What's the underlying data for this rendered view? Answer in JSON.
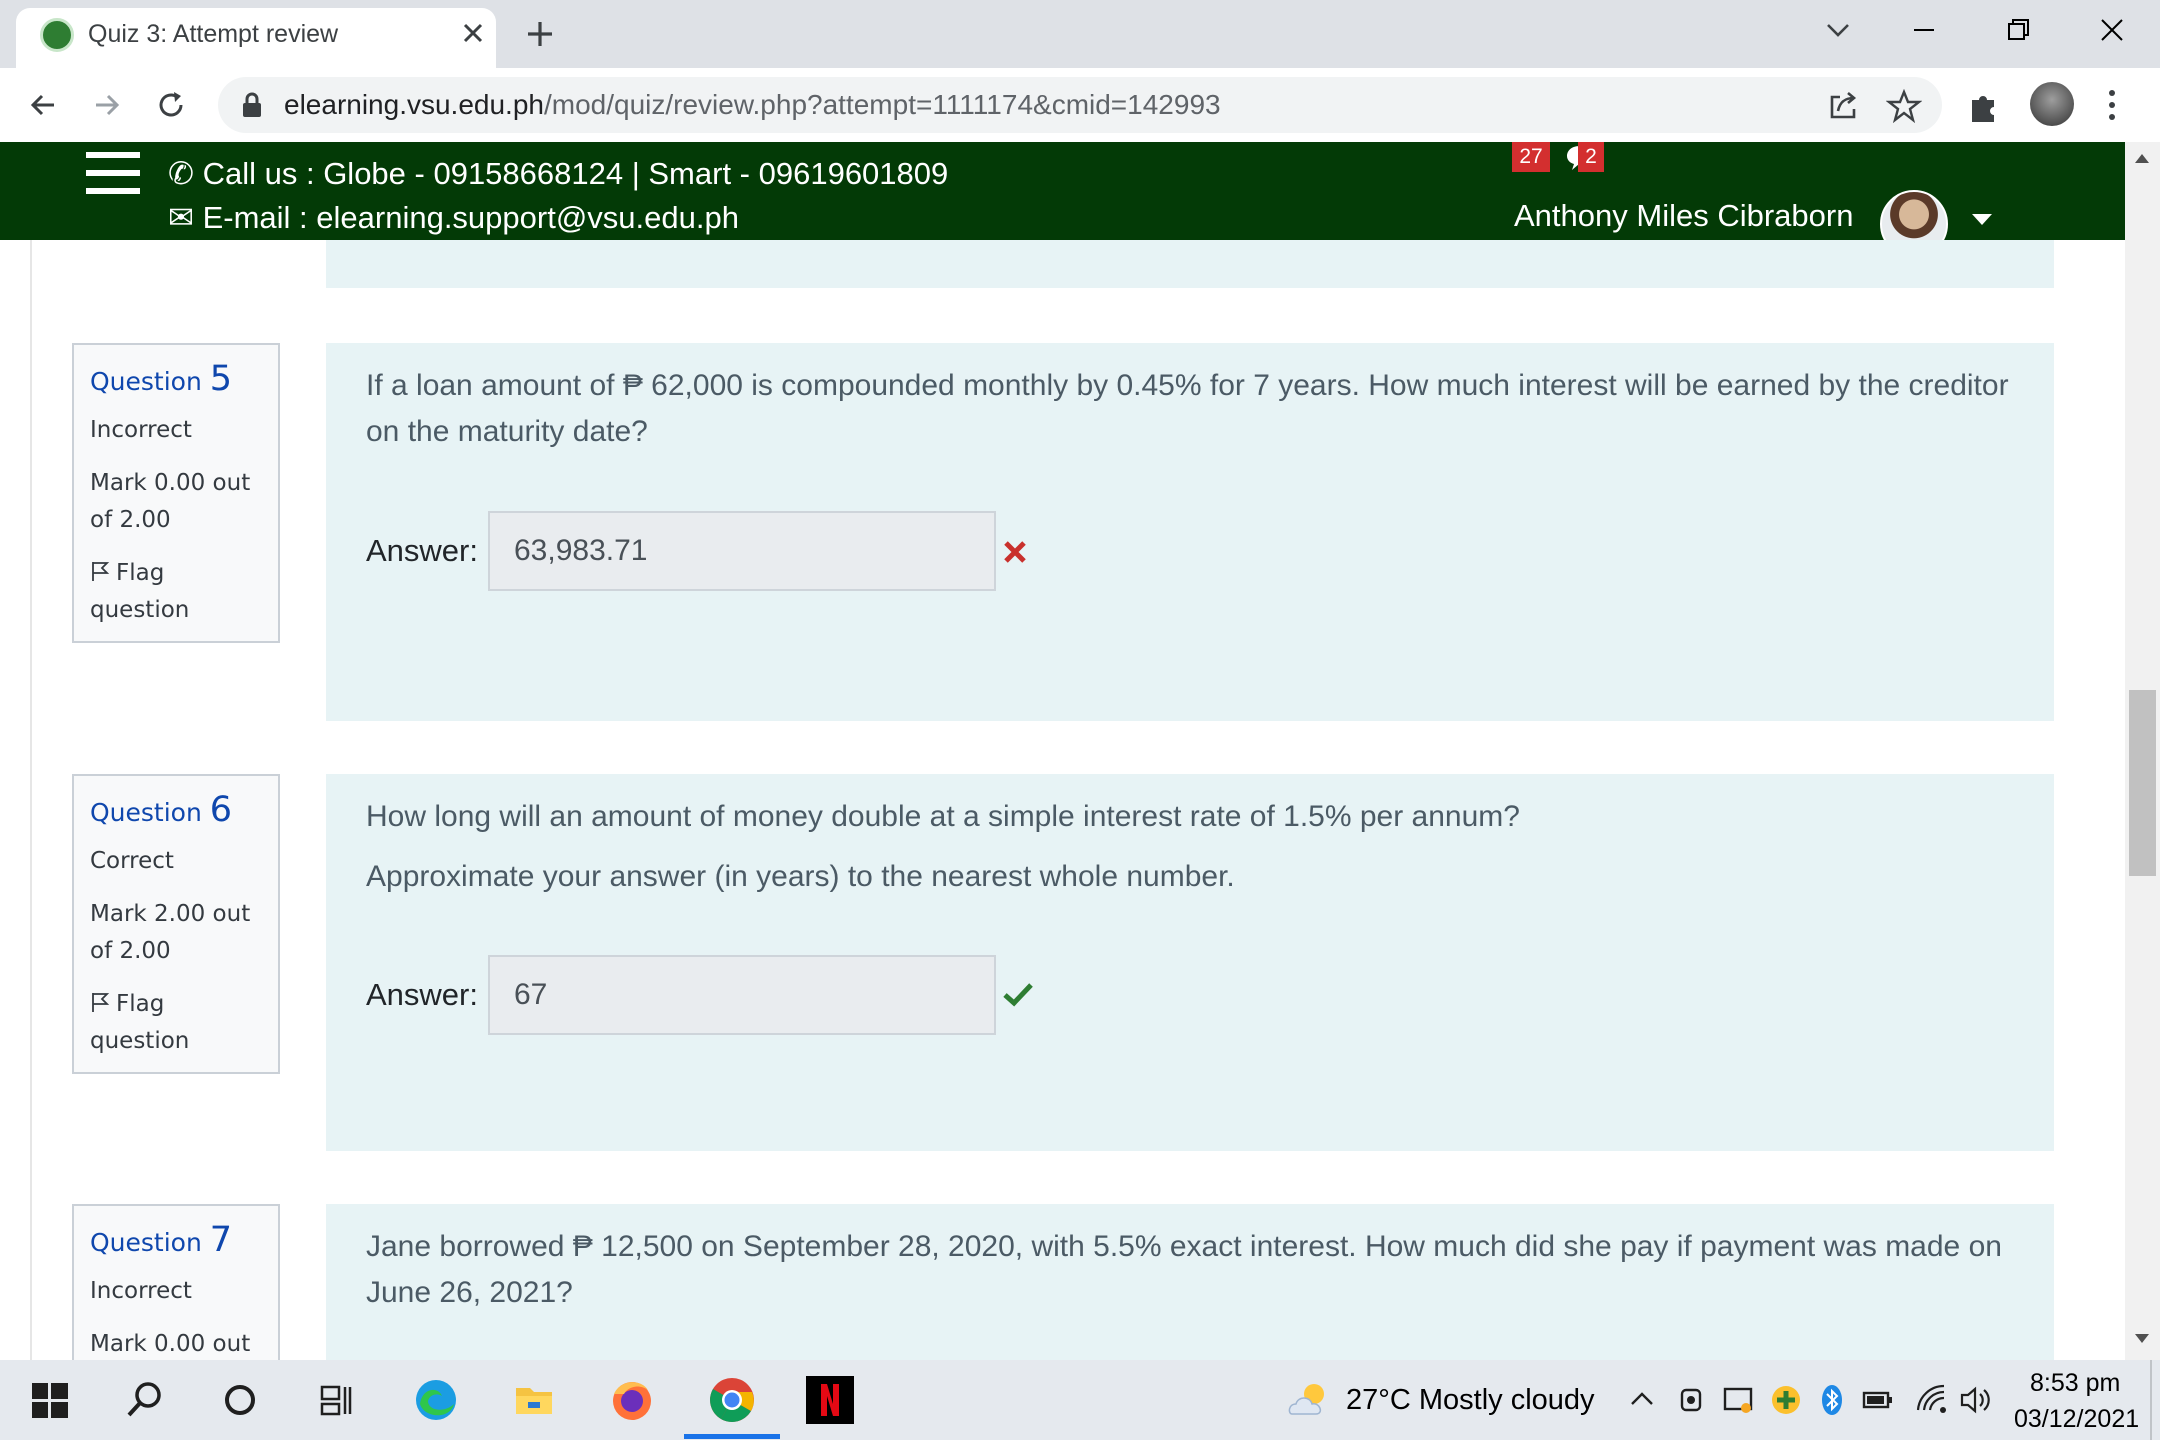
{
  "browser": {
    "tab_title": "Quiz 3: Attempt review",
    "url_host": "elearning.vsu.edu.ph",
    "url_path": "/mod/quiz/review.php?attempt=1111174&cmid=142993"
  },
  "site_header": {
    "call_text": "Call us : Globe - 09158668124 | Smart - 09619601809",
    "email_text": "E-mail : elearning.support@vsu.edu.ph",
    "notification_count": "27",
    "message_count": "2",
    "user_name": "Anthony Miles Cibraborn"
  },
  "questions": [
    {
      "label": "Question",
      "number": "5",
      "state": "Incorrect",
      "grade_line1": "Mark 0.00 out",
      "grade_line2": "of 2.00",
      "flag_line1": "Flag",
      "flag_line2": "question",
      "text": [
        "If a loan amount of ₱ 62,000 is compounded monthly by 0.45% for 7 years. How much interest will be earned by the creditor on the maturity date?"
      ],
      "answer_label": "Answer:",
      "answer_value": "63,983.71",
      "result": "incorrect",
      "result_color": "#c9302c"
    },
    {
      "label": "Question",
      "number": "6",
      "state": "Correct",
      "grade_line1": "Mark 2.00 out",
      "grade_line2": "of 2.00",
      "flag_line1": "Flag",
      "flag_line2": "question",
      "text": [
        "How long will an amount of money double at a simple interest rate of 1.5% per annum?",
        "Approximate your answer (in years) to the nearest whole number."
      ],
      "answer_label": "Answer:",
      "answer_value": "67",
      "result": "correct",
      "result_color": "#2e7d32"
    },
    {
      "label": "Question",
      "number": "7",
      "state": "Incorrect",
      "grade_line1": "Mark 0.00 out",
      "text": [
        "Jane borrowed ₱ 12,500 on September 28, 2020, with 5.5% exact interest. How much did she pay if payment was made on June 26, 2021?"
      ]
    }
  ],
  "taskbar": {
    "weather": "27°C  Mostly cloudy",
    "time": "8:53 pm",
    "date": "03/12/2021"
  },
  "colors": {
    "header_bg": "#033a06",
    "question_bg": "#e7f3f5",
    "link_blue": "#0f47ad",
    "badge_red": "#d32f2f"
  }
}
